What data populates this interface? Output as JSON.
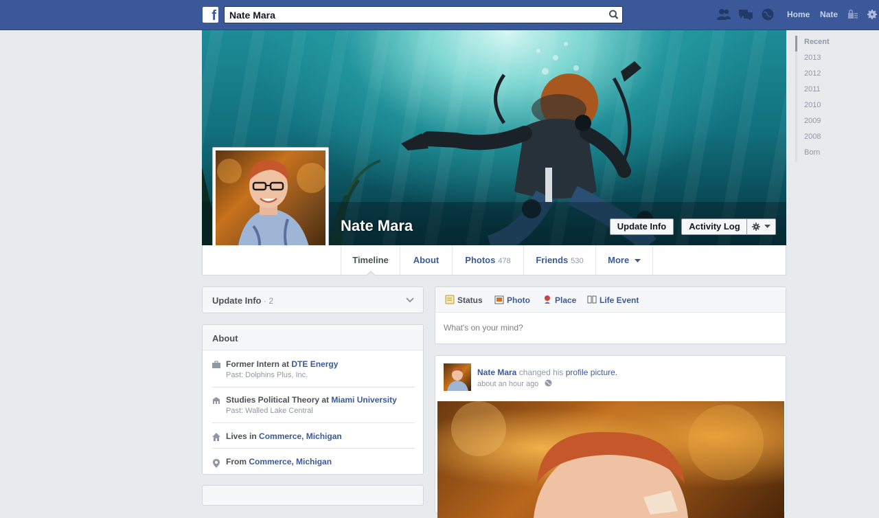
{
  "topbar": {
    "search_value": "Nate Mara",
    "home_label": "Home",
    "user_label": "Nate"
  },
  "cover": {
    "name": "Nate Mara",
    "update_info_label": "Update Info",
    "activity_log_label": "Activity Log"
  },
  "nav": {
    "tabs": [
      {
        "label": "Timeline",
        "count": ""
      },
      {
        "label": "About",
        "count": ""
      },
      {
        "label": "Photos",
        "count": "478"
      },
      {
        "label": "Friends",
        "count": "530"
      },
      {
        "label": "More",
        "count": ""
      }
    ]
  },
  "scrubber": {
    "items": [
      "Recent",
      "2013",
      "2012",
      "2011",
      "2010",
      "2009",
      "2008",
      "Born"
    ]
  },
  "update_info": {
    "label": "Update Info",
    "count": " · 2"
  },
  "about": {
    "title": "About",
    "work_prefix": "Former Intern at ",
    "work_link": "DTE Energy",
    "work_sub": "Past: Dolphins Plus, Inc.",
    "edu_prefix": "Studies Political Theory at ",
    "edu_link": "Miami University",
    "edu_sub": "Past: Walled Lake Central",
    "lives_prefix": "Lives in ",
    "lives_link": "Commerce, Michigan",
    "from_prefix": "From ",
    "from_link": "Commerce, Michigan"
  },
  "composer": {
    "tabs": [
      "Status",
      "Photo",
      "Place",
      "Life Event"
    ],
    "placeholder": "What's on your mind?"
  },
  "post": {
    "author": "Nate Mara",
    "action": " changed his ",
    "object": "profile picture.",
    "time": "about an hour ago"
  },
  "colors": {
    "brand": "#3b5998",
    "background": "#e9eaed"
  }
}
